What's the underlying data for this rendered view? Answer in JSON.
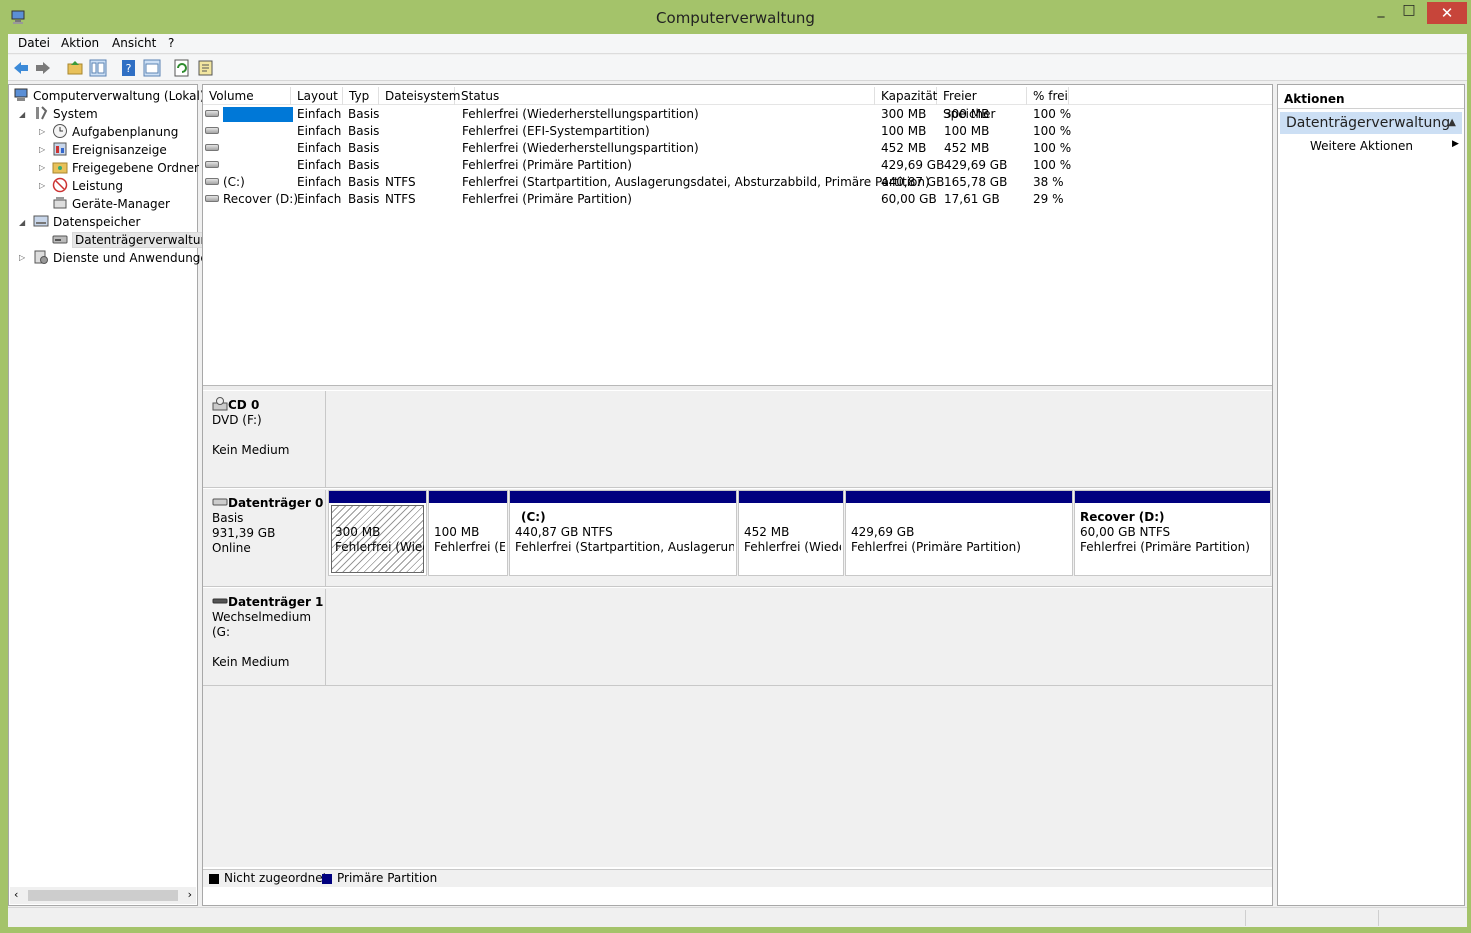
{
  "window": {
    "title": "Computerverwaltung"
  },
  "menu": [
    "Datei",
    "Aktion",
    "Ansicht",
    "?"
  ],
  "toolbar_icons": [
    "back-arrow-icon",
    "forward-arrow-icon",
    "up-folder-icon",
    "show-tree-icon",
    "help-icon",
    "properties-icon",
    "refresh-icon",
    "export-icon"
  ],
  "tree": {
    "root": "Computerverwaltung (Lokal)",
    "system": "System",
    "aufgaben": "Aufgabenplanung",
    "ereignis": "Ereignisanzeige",
    "freigegeben": "Freigegebene Ordner",
    "leistung": "Leistung",
    "geraete": "Geräte-Manager",
    "datenspeicher": "Datenspeicher",
    "datentraeger": "Datenträgerverwaltung",
    "dienste": "Dienste und Anwendungen"
  },
  "columns": [
    "Volume",
    "Layout",
    "Typ",
    "Dateisystem",
    "Status",
    "Kapazität",
    "Freier Speicher",
    "% frei"
  ],
  "volumes": [
    {
      "volume": "",
      "layout": "Einfach",
      "typ": "Basis",
      "fs": "",
      "status": "Fehlerfrei (Wiederherstellungspartition)",
      "cap": "300 MB",
      "free": "300 MB",
      "pct": "100 %"
    },
    {
      "volume": "",
      "layout": "Einfach",
      "typ": "Basis",
      "fs": "",
      "status": "Fehlerfrei (EFI-Systempartition)",
      "cap": "100 MB",
      "free": "100 MB",
      "pct": "100 %"
    },
    {
      "volume": "",
      "layout": "Einfach",
      "typ": "Basis",
      "fs": "",
      "status": "Fehlerfrei (Wiederherstellungspartition)",
      "cap": "452 MB",
      "free": "452 MB",
      "pct": "100 %"
    },
    {
      "volume": "",
      "layout": "Einfach",
      "typ": "Basis",
      "fs": "",
      "status": "Fehlerfrei (Primäre Partition)",
      "cap": "429,69 GB",
      "free": "429,69 GB",
      "pct": "100 %"
    },
    {
      "volume": "(C:)",
      "layout": "Einfach",
      "typ": "Basis",
      "fs": "NTFS",
      "status": "Fehlerfrei (Startpartition, Auslagerungsdatei, Absturzabbild, Primäre Partition)",
      "cap": "440,87 GB",
      "free": "165,78 GB",
      "pct": "38 %"
    },
    {
      "volume": "Recover (D:)",
      "layout": "Einfach",
      "typ": "Basis",
      "fs": "NTFS",
      "status": "Fehlerfrei (Primäre Partition)",
      "cap": "60,00 GB",
      "free": "17,61 GB",
      "pct": "29 %"
    }
  ],
  "disks": {
    "cd0": {
      "name": "CD 0",
      "line1": "DVD (F:)",
      "line2": "Kein Medium"
    },
    "disk0": {
      "name": "Datenträger 0",
      "line1": "Basis",
      "line2": "931,39 GB",
      "line3": "Online"
    },
    "disk1": {
      "name": "Datenträger 1",
      "line1": "Wechselmedium (G:",
      "line2": "Kein Medium"
    }
  },
  "partitions": [
    {
      "title": "",
      "size": "300 MB",
      "status": "Fehlerfrei (Wied"
    },
    {
      "title": "",
      "size": "100 MB",
      "status": "Fehlerfrei (EF"
    },
    {
      "title": "(C:)",
      "size": "440,87 GB NTFS",
      "status": "Fehlerfrei (Startpartition, Auslagerungsda"
    },
    {
      "title": "",
      "size": "452 MB",
      "status": "Fehlerfrei (Wiede"
    },
    {
      "title": "",
      "size": "429,69 GB",
      "status": "Fehlerfrei (Primäre Partition)"
    },
    {
      "title": "Recover  (D:)",
      "size": "60,00 GB NTFS",
      "status": "Fehlerfrei (Primäre Partition)"
    }
  ],
  "legend": {
    "unallocated": "Nicht zugeordnet",
    "primary": "Primäre Partition",
    "unallocated_color": "#000000",
    "primary_color": "#00007f"
  },
  "actions": {
    "header": "Aktionen",
    "section": "Datenträgerverwaltung",
    "item": "Weitere Aktionen"
  },
  "colors": {
    "titlebar": "#a4c36a",
    "close": "#c7453a",
    "selection": "#0078d7"
  }
}
